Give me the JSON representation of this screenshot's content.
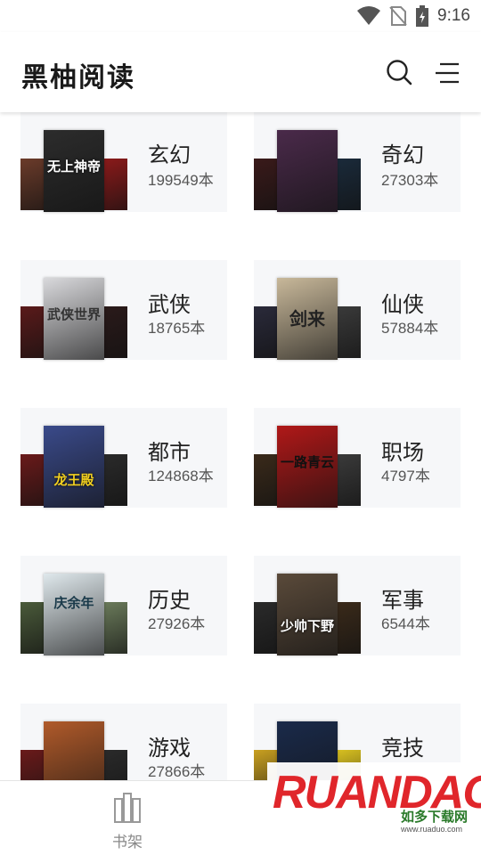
{
  "status_bar": {
    "time": "9:16"
  },
  "app_bar": {
    "title": "黑柚阅读"
  },
  "categories": [
    {
      "name": "玄幻",
      "count": "199549本",
      "cover_title": "无上神帝",
      "colors": [
        "#6b3b2a",
        "#2c2c2c",
        "#8a1a1a"
      ]
    },
    {
      "name": "奇幻",
      "count": "27303本",
      "cover_title": "",
      "colors": [
        "#3a1a1a",
        "#4a2a4a",
        "#1a2a3a"
      ]
    },
    {
      "name": "武侠",
      "count": "18765本",
      "cover_title": "武侠世界",
      "colors": [
        "#5a1a1a",
        "#d9d9dc",
        "#2a1a1a"
      ]
    },
    {
      "name": "仙侠",
      "count": "57884本",
      "cover_title": "剑来",
      "colors": [
        "#2a2a3a",
        "#c8b89a",
        "#3a3a3a"
      ]
    },
    {
      "name": "都市",
      "count": "124868本",
      "cover_title": "龙王殿",
      "colors": [
        "#6a1a1a",
        "#3a4a8a",
        "#2a2a2a"
      ]
    },
    {
      "name": "职场",
      "count": "4797本",
      "cover_title": "一路青云",
      "colors": [
        "#3a2a1a",
        "#b01818",
        "#3a3a3a"
      ]
    },
    {
      "name": "历史",
      "count": "27926本",
      "cover_title": "庆余年",
      "colors": [
        "#4a5a3a",
        "#dfe8ec",
        "#6a7a5a"
      ]
    },
    {
      "name": "军事",
      "count": "6544本",
      "cover_title": "少帅下野",
      "colors": [
        "#2a2a2a",
        "#5a4a3a",
        "#3a2a1a"
      ]
    },
    {
      "name": "游戏",
      "count": "27866本",
      "cover_title": "",
      "colors": [
        "#6a1a1a",
        "#b05a2a",
        "#2a2a2a"
      ]
    },
    {
      "name": "竞技",
      "count": "",
      "cover_title": "",
      "colors": [
        "#c9a020",
        "#1a2a4a",
        "#d8c020"
      ]
    }
  ],
  "bottom_nav": {
    "bookshelf_label": "书架"
  },
  "watermark": {
    "text": "RUANDAO",
    "sub": "如多下载网",
    "url": "www.ruaduo.com"
  }
}
